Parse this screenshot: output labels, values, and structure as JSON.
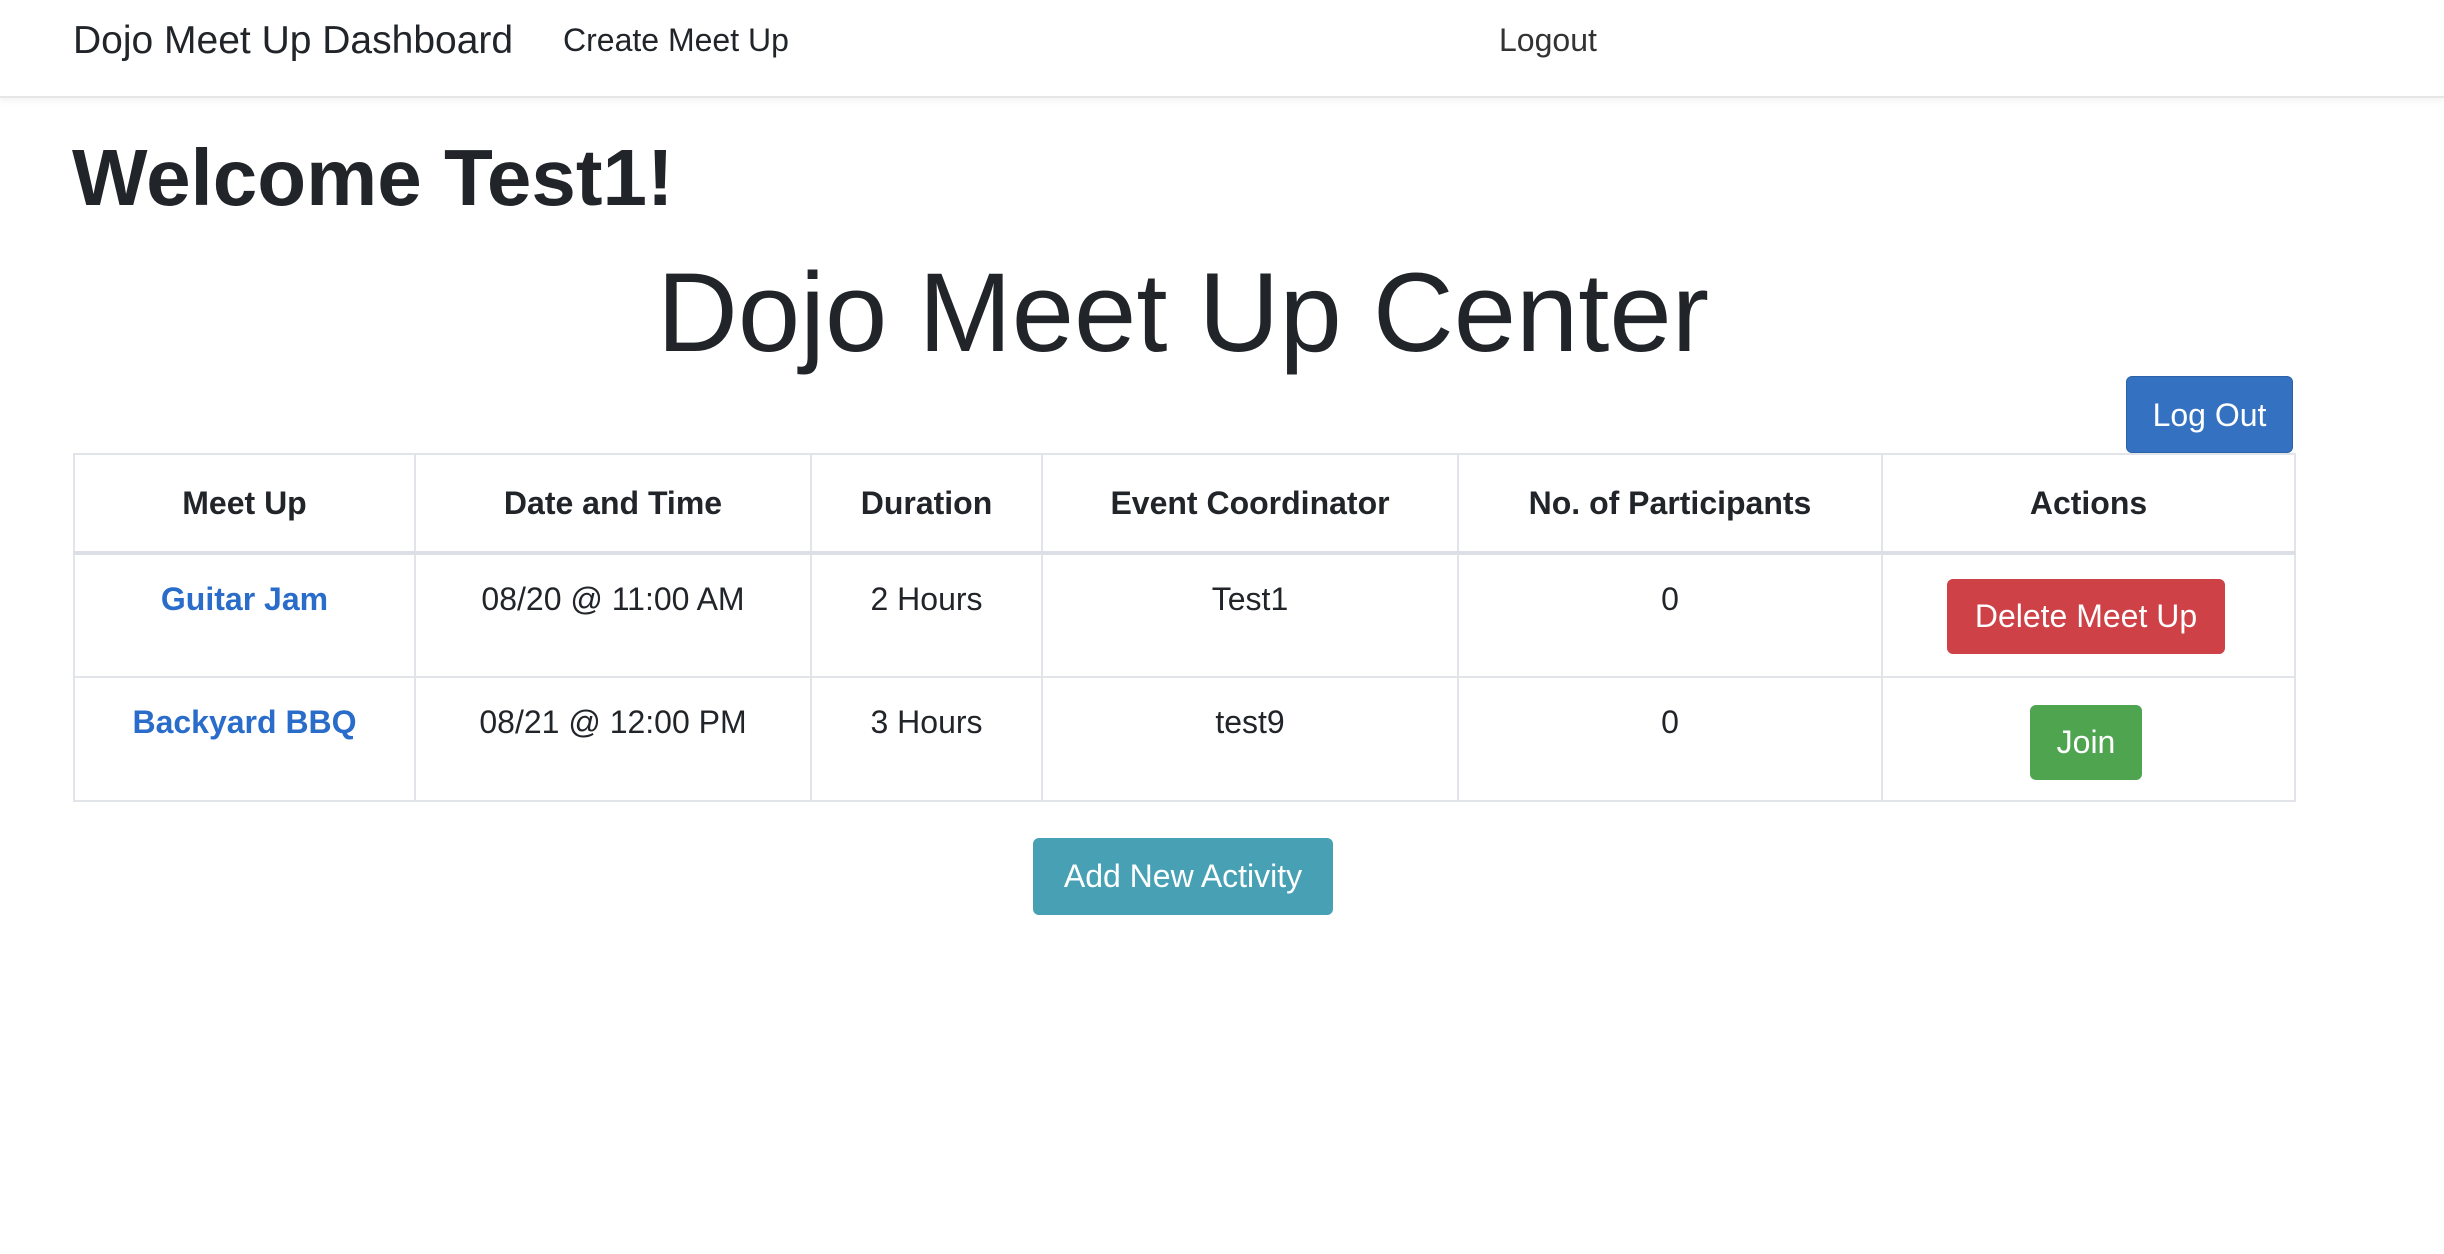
{
  "navbar": {
    "brand": "Dojo Meet Up Dashboard",
    "create_link": "Create Meet Up",
    "logout_link": "Logout"
  },
  "welcome": "Welcome Test1!",
  "page_title": "Dojo Meet Up Center",
  "logout_button": "Log Out",
  "table": {
    "headers": [
      "Meet Up",
      "Date and Time",
      "Duration",
      "Event Coordinator",
      "No. of Participants",
      "Actions"
    ],
    "rows": [
      {
        "meetup": "Guitar Jam",
        "datetime": "08/20 @ 11:00 AM",
        "duration": "2 Hours",
        "coordinator": "Test1",
        "participants": "0",
        "action": "Delete Meet Up"
      },
      {
        "meetup": "Backyard BBQ",
        "datetime": "08/21 @ 12:00 PM",
        "duration": "3 Hours",
        "coordinator": "test9",
        "participants": "0",
        "action": "Join"
      }
    ]
  },
  "add_button": "Add New Activity",
  "colors": {
    "primary": "#3472c1",
    "danger": "#cd4147",
    "success": "#4fa450",
    "info": "#47a0b4",
    "link": "#2a6cc9"
  }
}
